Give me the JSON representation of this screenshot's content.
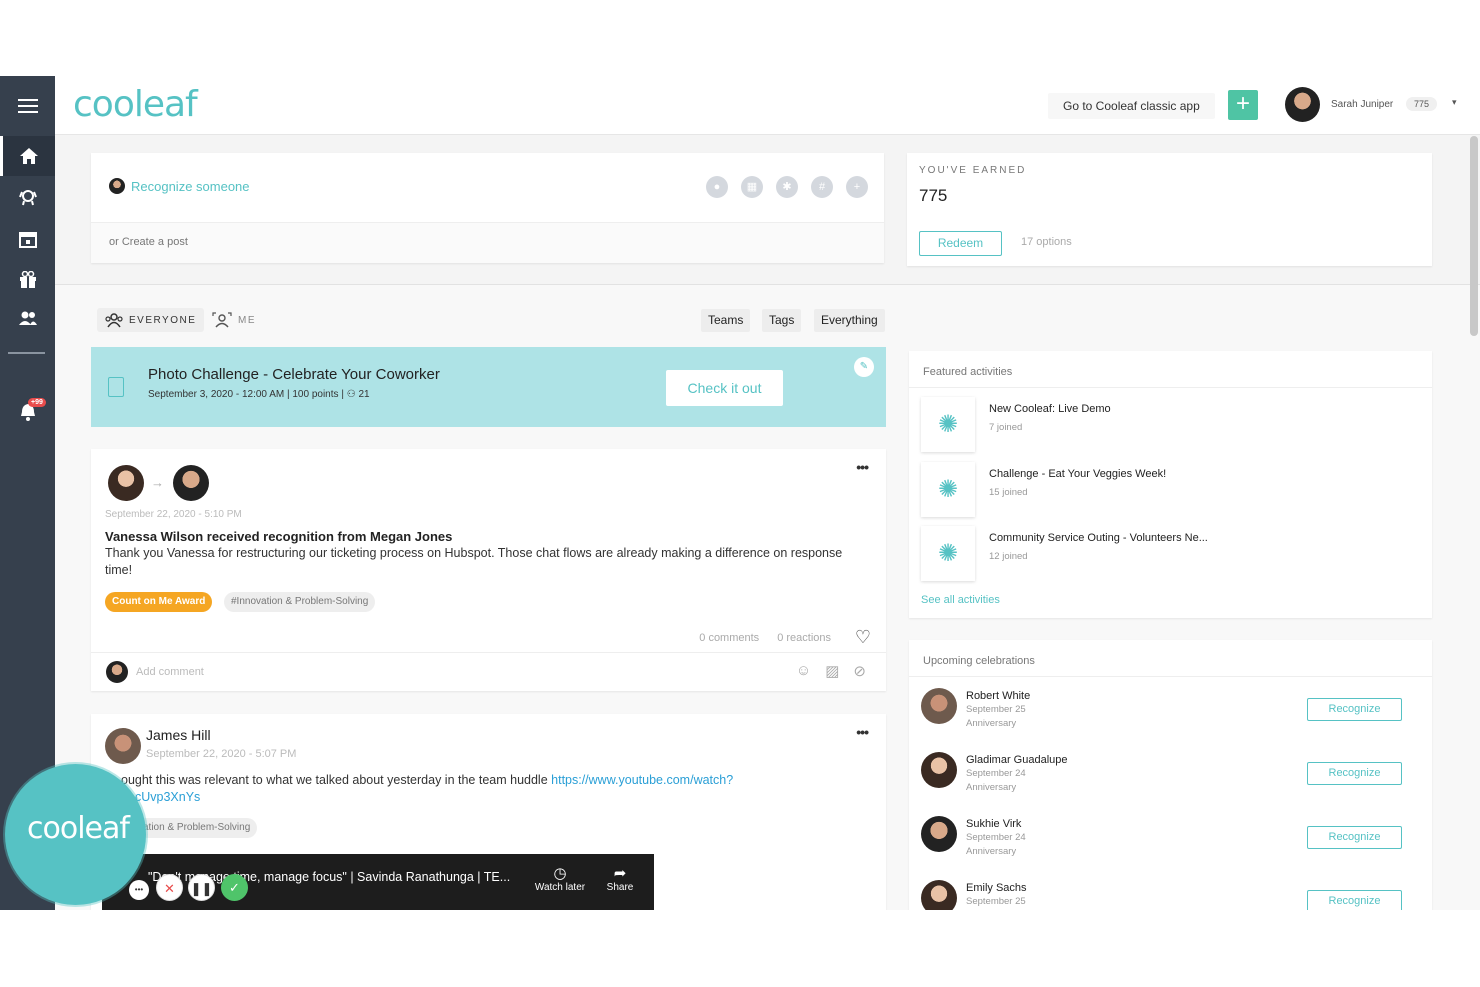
{
  "app": {
    "logo": "cooleaf"
  },
  "sidebar": {
    "notif_badge": "+99",
    "items": [
      {
        "icon": "home-icon"
      },
      {
        "icon": "award-icon"
      },
      {
        "icon": "calendar-icon"
      },
      {
        "icon": "gift-icon"
      },
      {
        "icon": "people-icon"
      },
      {
        "icon": "bell-icon"
      }
    ]
  },
  "header": {
    "classic_link": "Go to Cooleaf classic app",
    "plus": "+",
    "user_name": "Sarah Juniper",
    "user_points": "775",
    "caret": "▾"
  },
  "recognize": {
    "label": "Recognize someone",
    "create_post": "or Create a post"
  },
  "earned": {
    "label": "YOU'VE EARNED",
    "points": "775",
    "redeem": "Redeem",
    "options": "17 options"
  },
  "filters": {
    "everyone": "EVERYONE",
    "me": "ME",
    "tabs": [
      "Teams",
      "Tags",
      "Everything"
    ]
  },
  "challenge": {
    "title": "Photo Challenge - Celebrate Your Coworker",
    "date": "September 3, 2020 - 12:00 AM",
    "points": "100 points",
    "participants": "21",
    "cta": "Check it out"
  },
  "post1": {
    "date": "September 22, 2020 - 5:10 PM",
    "title": "Vanessa Wilson received recognition from Megan Jones",
    "body": "Thank you Vanessa for restructuring our ticketing process on Hubspot. Those chat flows are already making a difference on response time!",
    "award": "Count on Me Award",
    "tag": "#Innovation & Problem-Solving",
    "comments": "0 comments",
    "reactions": "0 reactions",
    "comment_placeholder": "Add comment"
  },
  "post2": {
    "author": "James Hill",
    "date": "September 22, 2020 - 5:07 PM",
    "body_start": "ought this was relevant to what we talked about yesterday in the team huddle",
    "link": "https://www.youtube.com/watch?",
    "link_cont": "cUvp3XnYs",
    "tag": "ation & Problem-Solving",
    "video_title": "\"Don't manage time, manage focus\" | Savinda Ranathunga | TE...",
    "watch_later": "Watch later",
    "share": "Share"
  },
  "bubble": {
    "logo": "cooleaf"
  },
  "featured": {
    "title": "Featured activities",
    "items": [
      {
        "name": "New Cooleaf: Live Demo",
        "joined": "7 joined"
      },
      {
        "name": "Challenge - Eat Your Veggies Week!",
        "joined": "15 joined"
      },
      {
        "name": "Community Service Outing - Volunteers Ne...",
        "joined": "12 joined"
      }
    ],
    "see_all": "See all activities"
  },
  "celebrations": {
    "title": "Upcoming celebrations",
    "button": "Recognize",
    "items": [
      {
        "name": "Robert White",
        "date": "September 25",
        "type": "Anniversary"
      },
      {
        "name": "Gladimar Guadalupe",
        "date": "September 24",
        "type": "Anniversary"
      },
      {
        "name": "Sukhie Virk",
        "date": "September 24",
        "type": "Anniversary"
      },
      {
        "name": "Emily Sachs",
        "date": "September 25",
        "type": ""
      }
    ]
  }
}
